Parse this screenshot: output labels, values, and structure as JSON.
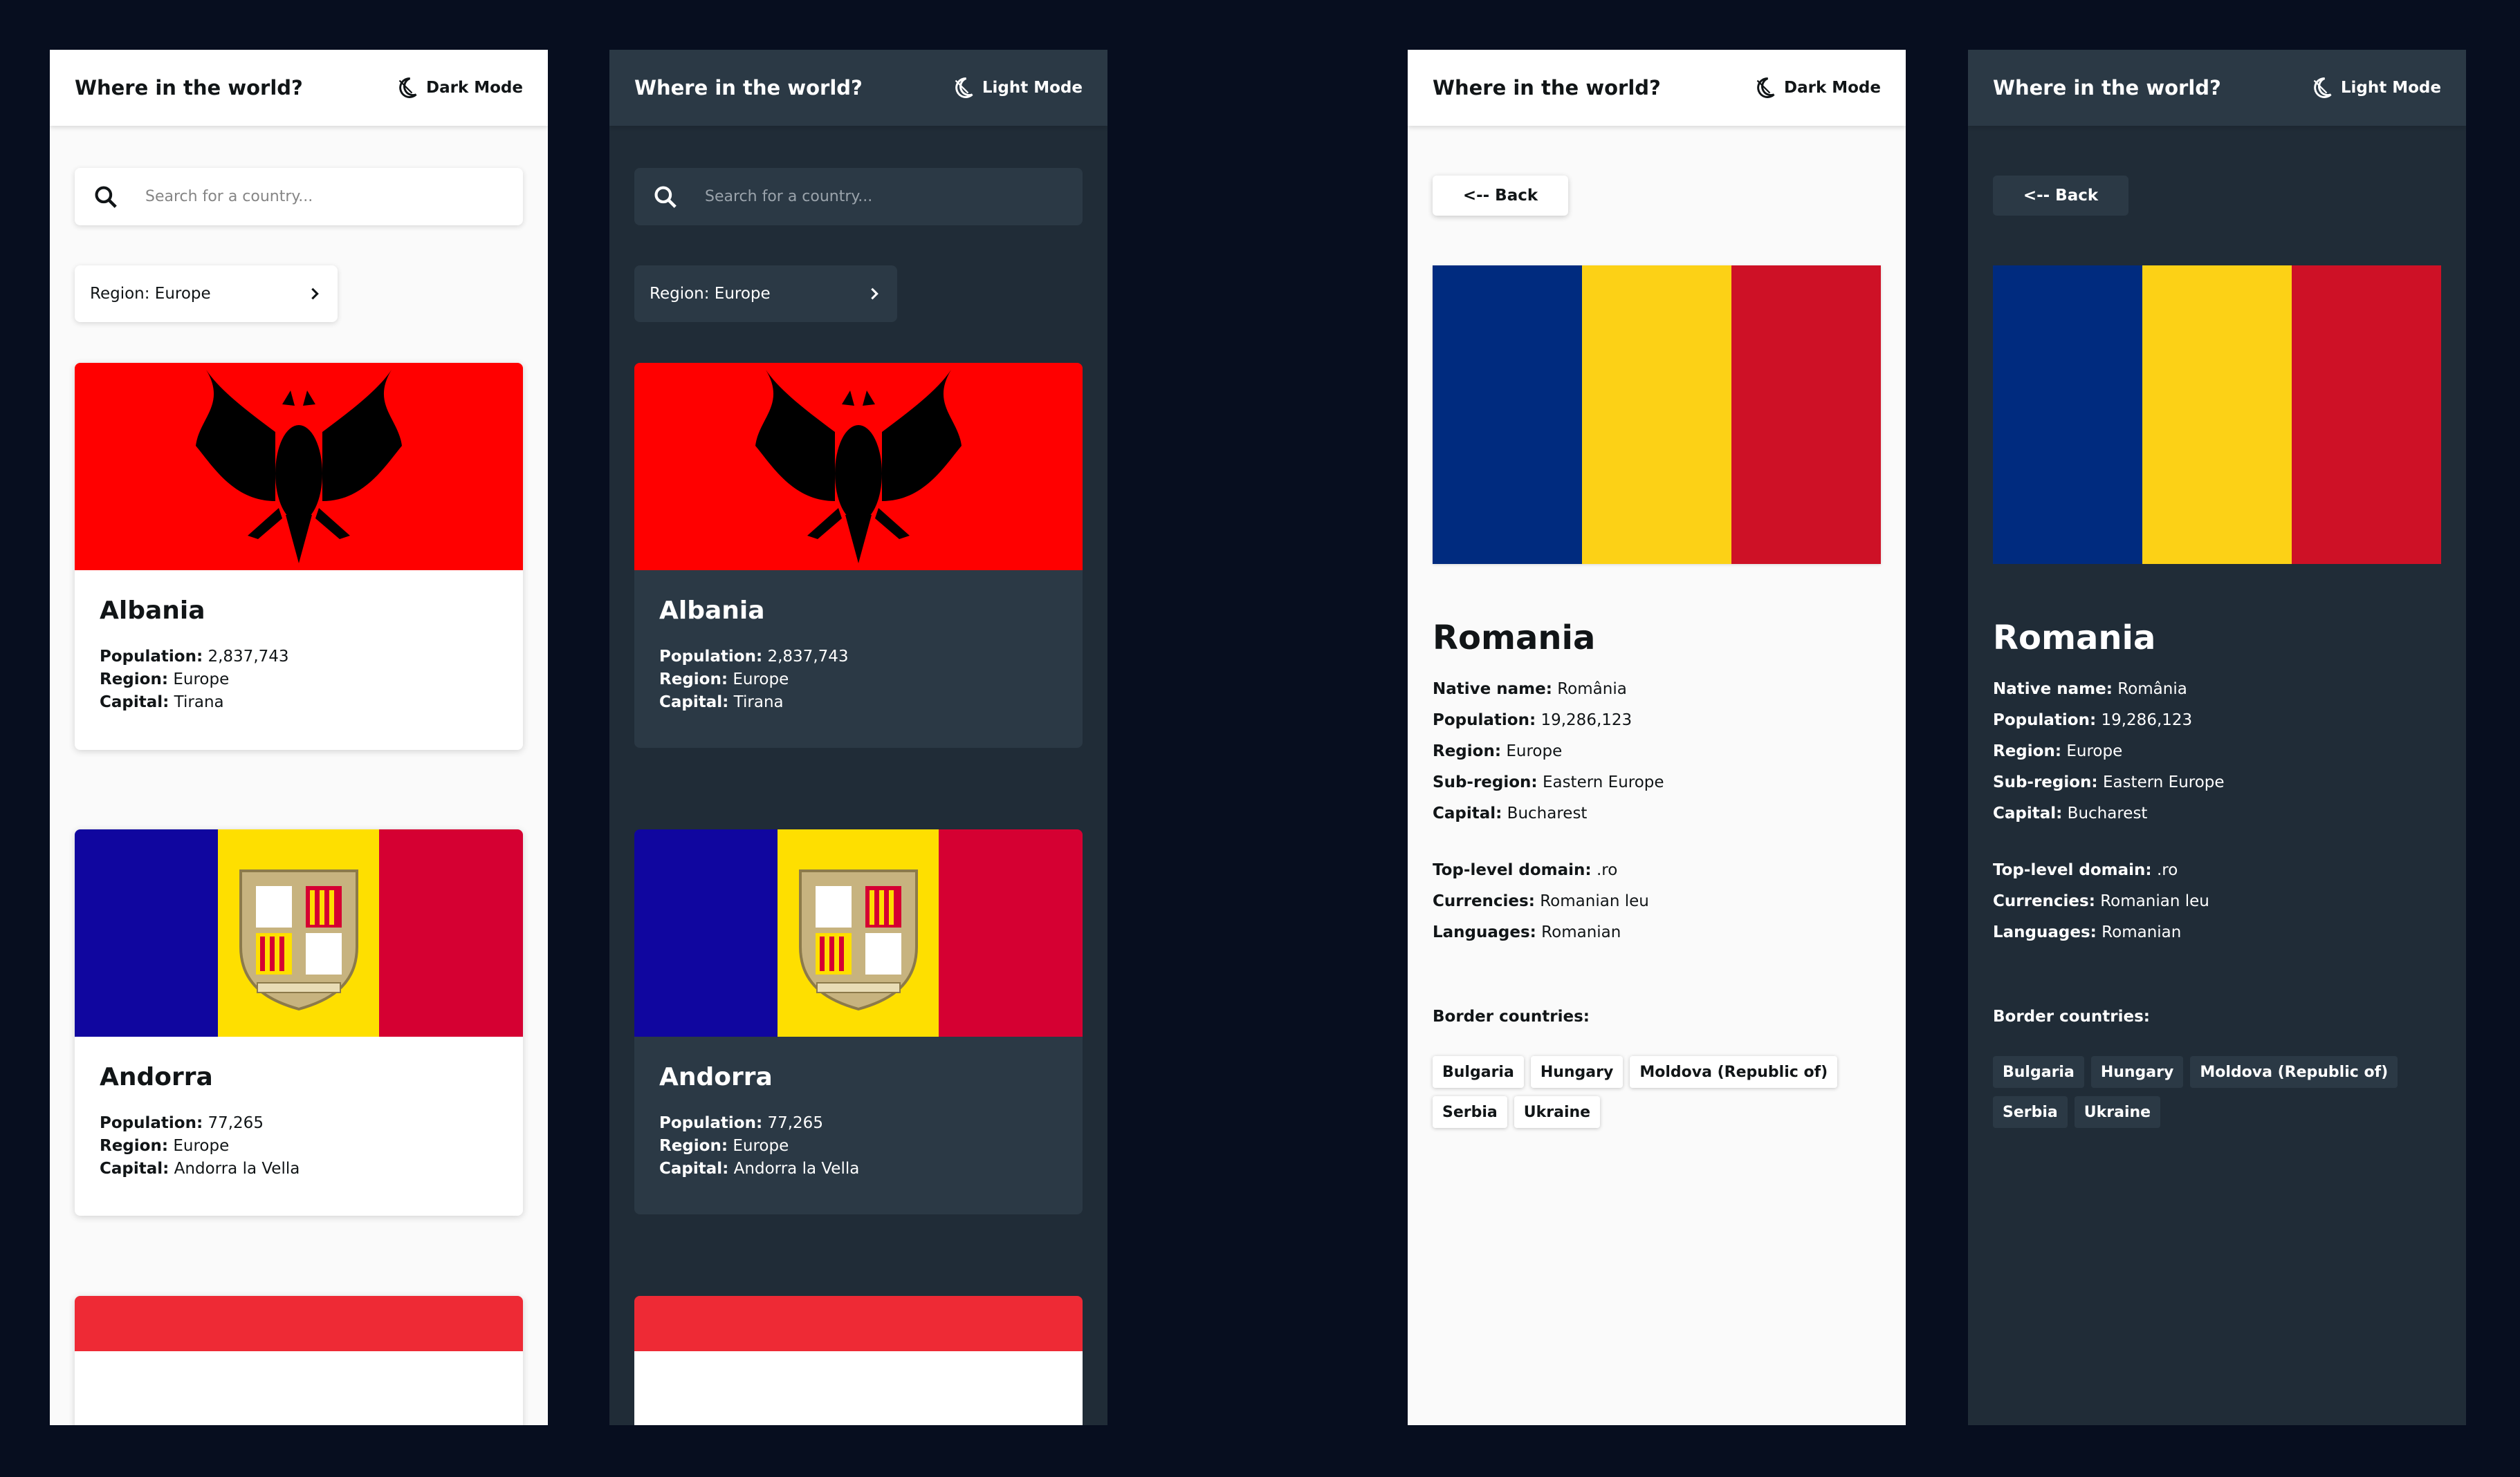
{
  "header": {
    "title": "Where in the world?",
    "dark_mode_label": "Dark Mode",
    "light_mode_label": "Light Mode"
  },
  "search": {
    "placeholder": "Search for a country..."
  },
  "filter": {
    "label": "Region: Europe"
  },
  "labels": {
    "population": "Population:",
    "region": "Region:",
    "capital": "Capital:",
    "native_name": "Native name:",
    "sub_region": "Sub-region:",
    "top_level_domain": "Top-level domain:",
    "currencies": "Currencies:",
    "languages": "Languages:",
    "border_countries": "Border countries:"
  },
  "countries": [
    {
      "name": "Albania",
      "population": "2,837,743",
      "region": "Europe",
      "capital": "Tirana"
    },
    {
      "name": "Andorra",
      "population": "77,265",
      "region": "Europe",
      "capital": "Andorra la Vella"
    }
  ],
  "detail": {
    "back_label": "<-- Back",
    "name": "Romania",
    "native_name": "România",
    "population": "19,286,123",
    "region": "Europe",
    "sub_region": "Eastern Europe",
    "capital": "Bucharest",
    "top_level_domain": ".ro",
    "currencies": "Romanian leu",
    "languages": "Romanian",
    "borders": [
      "Bulgaria",
      "Hungary",
      "Moldova (Republic of)",
      "Serbia",
      "Ukraine"
    ]
  },
  "colors": {
    "page_bg": "#070e1f",
    "light_bg": "#fafafa",
    "dark_bg": "#202c37",
    "dark_element": "#2b3945",
    "albania_red": "#ff0000",
    "andorra_blue": "#10069f",
    "andorra_yellow": "#fedf00",
    "andorra_red": "#d50032",
    "romania_blue": "#002b7f",
    "romania_yellow": "#fcd116",
    "romania_red": "#ce1126",
    "monaco_red": "#ee2a35"
  },
  "icons": [
    "moon-icon",
    "search-icon",
    "chevron-right-icon"
  ]
}
